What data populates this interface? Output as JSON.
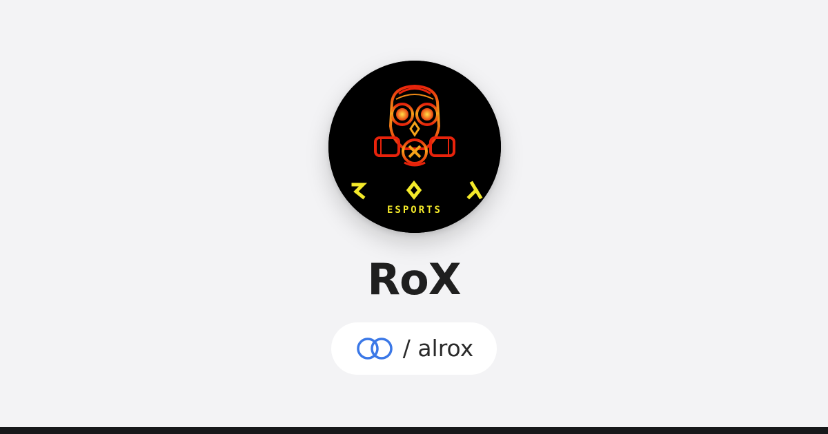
{
  "profile": {
    "name": "RoX",
    "handle": "/ alrox",
    "avatar": {
      "name": "rox-esports-logo",
      "letters": [
        "R",
        "O",
        "X"
      ],
      "subtitle": "ESPORTS",
      "colors": {
        "background": "#000000",
        "mask_outer": "#e02a0c",
        "mask_inner": "#f7a81b",
        "text": "#f4ea2a"
      }
    }
  },
  "link_icon": "link-rings-icon",
  "colors": {
    "page_background": "#f3f3f5",
    "name_text": "#1f1f1f",
    "pill_background": "#ffffff",
    "link_icon": "#3b78e7",
    "bottom_bar": "#17181a"
  }
}
